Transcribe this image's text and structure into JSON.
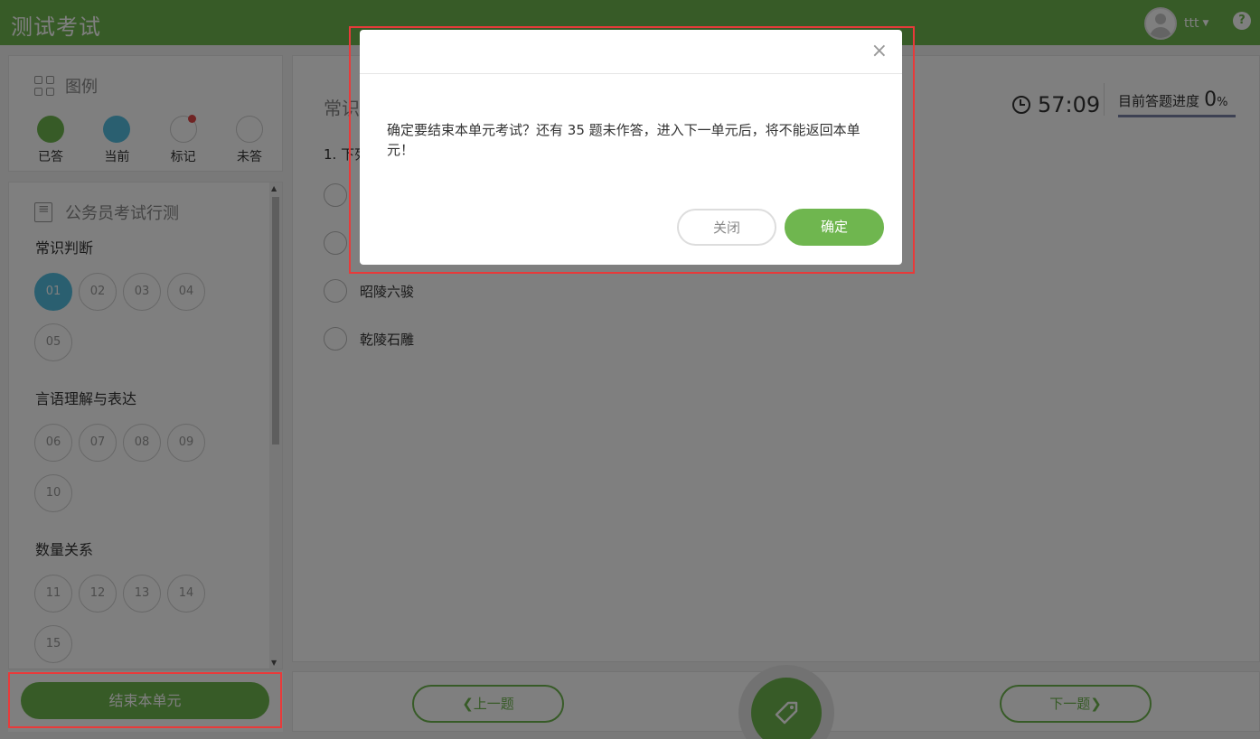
{
  "header": {
    "app_title": "测试考试",
    "username": "ttt",
    "help_icon": "?"
  },
  "legend": {
    "title": "图例",
    "items": [
      {
        "label": "已答"
      },
      {
        "label": "当前"
      },
      {
        "label": "标记"
      },
      {
        "label": "未答"
      }
    ]
  },
  "nav": {
    "title": "公务员考试行测",
    "sections": [
      {
        "title": "常识判断",
        "questions": [
          "01",
          "02",
          "03",
          "04",
          "05"
        ]
      },
      {
        "title": "言语理解与表达",
        "questions": [
          "06",
          "07",
          "08",
          "09",
          "10"
        ]
      },
      {
        "title": "数量关系",
        "questions": [
          "11",
          "12",
          "13",
          "14",
          "15"
        ]
      }
    ],
    "end_unit_label": "结束本单元"
  },
  "main": {
    "section_label": "常识",
    "timer": "57:09",
    "progress_label": "目前答题进度",
    "progress_value": "0",
    "progress_pct": "%",
    "question_text": "1. 下列",
    "options": [
      {
        "label": ""
      },
      {
        "label": ""
      },
      {
        "label": "昭陵六骏"
      },
      {
        "label": "乾陵石雕"
      }
    ],
    "prev_label": "上一题",
    "next_label": "下一题"
  },
  "modal": {
    "close_symbol": "×",
    "message": "确定要结束本单元考试？还有 35 题未作答，进入下一单元后，将不能返回本单元！",
    "cancel_label": "关闭",
    "ok_label": "确定"
  },
  "colors": {
    "brand": "#6fb64f",
    "current": "#55bfe0",
    "marked": "#e04848",
    "highlight": "#e83a3a"
  }
}
